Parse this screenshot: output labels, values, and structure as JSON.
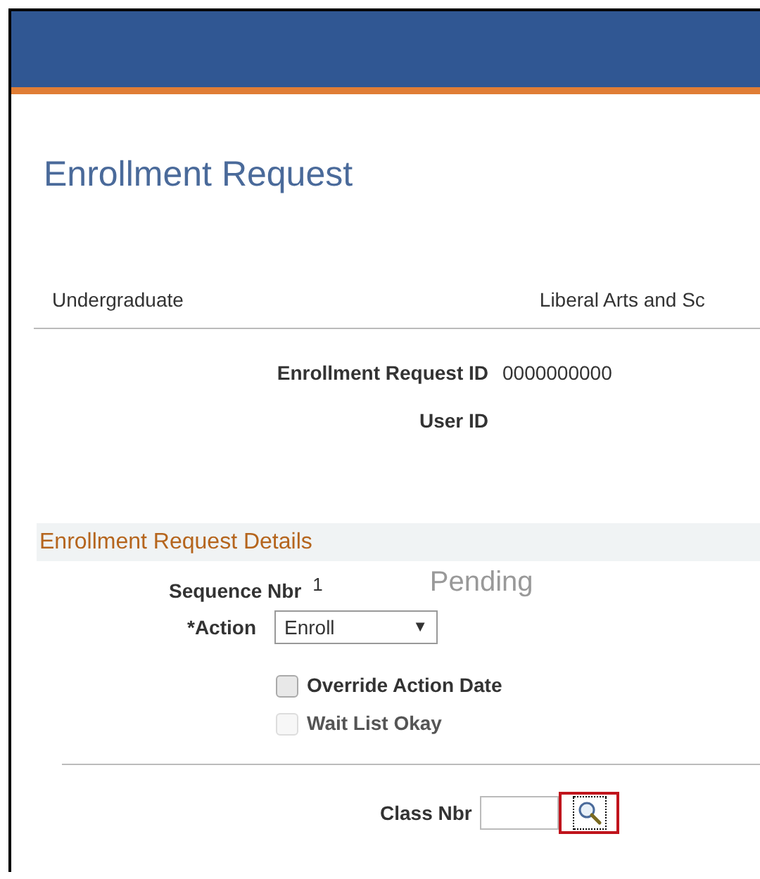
{
  "page": {
    "title": "Enrollment Request"
  },
  "career": {
    "level": "Undergraduate",
    "school": "Liberal Arts and Sc"
  },
  "request_fields": [
    {
      "label": "Enrollment Request ID",
      "value": "0000000000"
    },
    {
      "label": "User ID"
    }
  ],
  "details": {
    "heading": "Enrollment Request Details",
    "sequence": {
      "label": "Sequence Nbr",
      "value": "1"
    },
    "status": "Pending",
    "action": {
      "label": "*Action",
      "value": "Enroll",
      "caret": "▼"
    },
    "checkboxes": [
      {
        "label": "Override Action Date",
        "checked": false,
        "disabled": false
      },
      {
        "label": "Wait List Okay",
        "checked": false,
        "disabled": true
      }
    ],
    "class_nbr": {
      "label": "Class Nbr",
      "highlighted": true
    }
  }
}
